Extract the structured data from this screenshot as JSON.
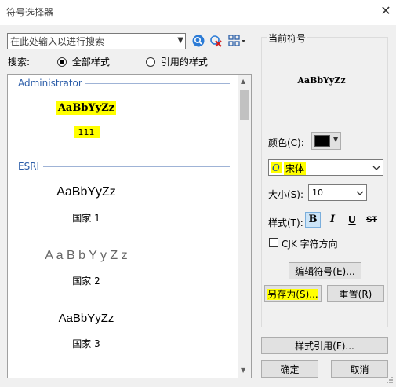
{
  "window": {
    "title": "符号选择器",
    "close": "✕"
  },
  "search": {
    "placeholder": "在此处输入以进行搜索",
    "label": "搜索:"
  },
  "scope": {
    "all_styles": "全部样式",
    "referenced_styles": "引用的样式",
    "selected": "all_styles"
  },
  "groups": [
    {
      "title": "Administrator",
      "symbols": [
        {
          "preview": "AaBbYyZz",
          "label": "111",
          "highlighted": true
        }
      ]
    },
    {
      "title": "ESRI",
      "symbols": [
        {
          "preview": "AaBbYyZz",
          "label": "国家 1"
        },
        {
          "preview": "A a B b Y y Z z",
          "label": "国家 2"
        },
        {
          "preview": "AaBbYyZz",
          "label": "国家 3"
        }
      ]
    }
  ],
  "current": {
    "title": "当前符号",
    "preview": "AaBbYyZz",
    "color_label": "颜色(C):",
    "color_value": "#000000",
    "font_name": "宋体",
    "size_label": "大小(S):",
    "size_value": "10",
    "style_label": "样式(T):",
    "bold": "B",
    "italic": "I",
    "underline": "U",
    "strike": "ST",
    "cjk_label": "CJK 字符方向",
    "edit_button": "编辑符号(E)...",
    "save_as_button": "另存为(S)...",
    "reset_button": "重置(R)"
  },
  "footer": {
    "style_refs_button": "样式引用(F)...",
    "ok_button": "确定",
    "cancel_button": "取消"
  },
  "colors": {
    "accent": "#2a5ca8",
    "highlight": "#ffff00"
  }
}
